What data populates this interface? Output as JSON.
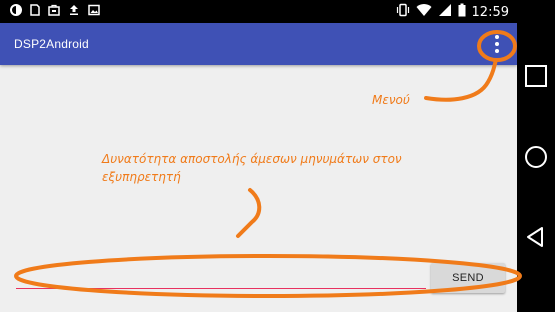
{
  "status_bar": {
    "time": "12:59",
    "left_icons": [
      "sync-icon",
      "sim-icon",
      "store-icon",
      "upload-icon",
      "image-icon"
    ],
    "right_icons": [
      "vibrate-icon",
      "wifi-icon",
      "signal-icon",
      "battery-icon"
    ]
  },
  "app_bar": {
    "title": "DSP2Android",
    "overflow_icon": "more-vert-icon"
  },
  "message": {
    "input_value": "",
    "send_label": "SEND",
    "accent_color": "#e8315f"
  },
  "annotations": {
    "color": "#f07b1a",
    "menu_label": "Μενού",
    "send_description": "Δυνατότητα αποστολής άμεσων μηνυμάτων στον εξυπηρετητή"
  },
  "nav_bar": {
    "buttons": [
      "recent-apps-icon",
      "home-icon",
      "back-icon"
    ]
  },
  "colors": {
    "app_bar": "#3f51b5",
    "background": "#efefef"
  }
}
